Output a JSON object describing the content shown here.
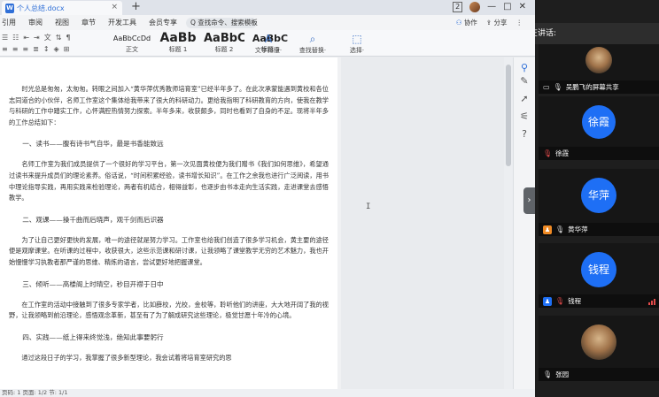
{
  "tabbar": {
    "doc_name": "个人总结.docx",
    "doc_icon": "W",
    "close_glyph": "×",
    "add_glyph": "+",
    "badge": "2",
    "window_glyphs": [
      "—",
      "□",
      "✕"
    ]
  },
  "menubar": {
    "items": [
      "引用",
      "审阅",
      "视图",
      "章节",
      "开发工具",
      "会员专享"
    ],
    "search_label": "Q 查找命令、搜索模板",
    "right": {
      "collab": "协作",
      "share": "分享"
    }
  },
  "ribbon": {
    "styles": [
      {
        "preview": "AaBbCcDd",
        "label": "正文"
      },
      {
        "preview": "AaBb",
        "label": "标题 1"
      },
      {
        "preview": "AaBbC",
        "label": "标题 2"
      },
      {
        "preview": "AaBbC",
        "label": "标题 3"
      }
    ],
    "tools": [
      {
        "icon": "A",
        "label": "文字排版·"
      },
      {
        "icon": "⌕",
        "label": "查找替换·"
      },
      {
        "icon": "⬚",
        "label": "选择·"
      }
    ]
  },
  "document": {
    "blocks": [
      {
        "type": "para",
        "text": "时光总是匆匆，太匆匆。转眼之间加入“黄华萍优秀教师培育室”已经半年多了。在此次承蒙能遇到黄校和各位志同道合的小伙伴，名师工作室这个集体给我带来了很大的科研动力。更给我指明了科研教育的方向，使我在教学与科研的工作中踏实工作，心怀满腔热情努力探索。半年多来，收获颇多，同时也看到了自身的不足。现将半年多的工作总结如下："
      },
      {
        "type": "heading",
        "text": "一、读书——腹有诗书气自华，最是书香能致远"
      },
      {
        "type": "para",
        "text": "名师工作室为我们成员提供了一个很好的学习平台，第一次见面黄校便为我们赠书《我们如何思维》，希望通过读书来提升成员们的理论素养。俗话说，“时间积累经验，读书增长知识”。在工作之余我也进行广泛阅读，用书中理论指导实践，再用实践来检验理论，两者有机结合，相得益彰，也逐步由书本走向生活实践，走进课堂去感悟教学。"
      },
      {
        "type": "heading",
        "text": "二、观课——操千曲而后晓声，观千剑而后识器"
      },
      {
        "type": "para",
        "text": "为了让自己更好更快的发展，唯一的途径就是努力学习。工作室也给我们创造了很多学习机会，黄主要的途径便是观摩课堂。在听课的过程中，收获很大，这些示范课和研讨课，让我领略了课堂教学无穷的艺术魅力，我也开始慢慢学习执教者那严谨的思维、精炼的语言，尝试更好地把握课堂。"
      },
      {
        "type": "heading",
        "text": "三、倾听——高楼阁上时晴空，秒目开襟于日中"
      },
      {
        "type": "para",
        "text": "在工作室的活动中接触到了很多专家学者，比如薛校，光校，金校等，聆听他们的讲座，大大地开阔了我的视野，让我领略到前沿理论，感悟观念革新，甚至有了为了解成研究这些理论，极觉甘愿十年冷的心境。"
      },
      {
        "type": "heading",
        "text": "四、实践——纸上得来终觉浅，绝知此事要躬行"
      },
      {
        "type": "para",
        "text": "通过这段日子的学习，我掌握了很多新型理论，我会试着将培育室研究的思"
      }
    ]
  },
  "statusbar": {
    "text": "页码: 1  页面: 1/2  节: 1/1"
  },
  "meeting": {
    "speaking_label": "正在讲话:",
    "tiles": [
      {
        "kind": "photo",
        "name": "吴鹏飞的屏幕共享",
        "badge": "screen"
      },
      {
        "kind": "text",
        "avatar_text": "徐霞",
        "name": "徐霞"
      },
      {
        "kind": "text",
        "avatar_text": "华萍",
        "name": "黄华萍"
      },
      {
        "kind": "text",
        "avatar_text": "钱程",
        "name": "钱程"
      },
      {
        "kind": "photo",
        "name": "张园"
      }
    ]
  },
  "colors": {
    "accent": "#2f6fd7",
    "avatar_blue": "#1e6ff5",
    "muted_red": "#e04a4a",
    "host_orange": "#f08a24"
  }
}
